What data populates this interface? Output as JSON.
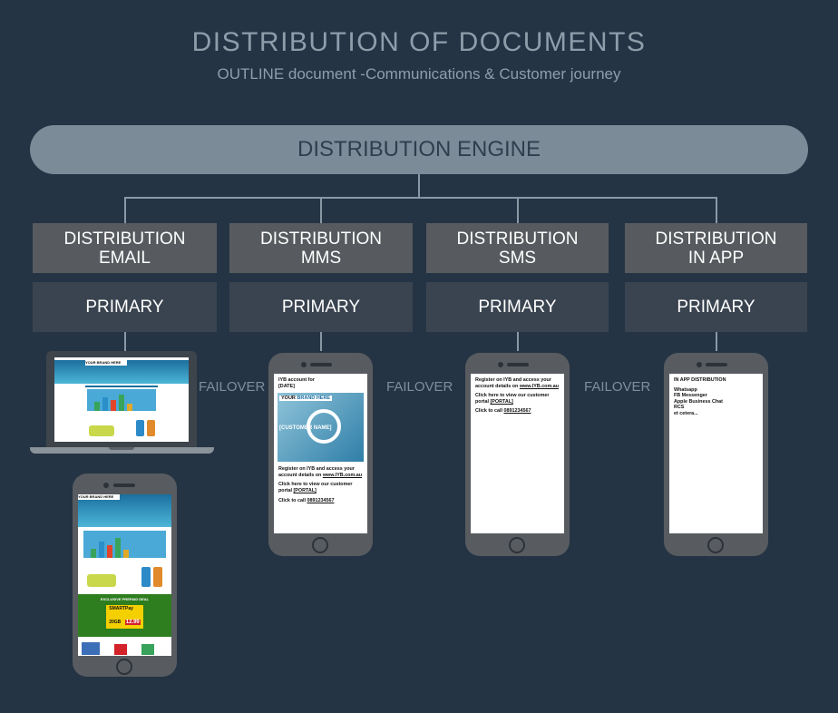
{
  "header": {
    "title": "DISTRIBUTION OF DOCUMENTS",
    "subtitle": "OUTLINE document -Communications & Customer journey"
  },
  "engine": {
    "label": "DISTRIBUTION ENGINE"
  },
  "channels": [
    {
      "line1": "DISTRIBUTION",
      "line2": "EMAIL",
      "primary": "PRIMARY"
    },
    {
      "line1": "DISTRIBUTION",
      "line2": "MMS",
      "primary": "PRIMARY"
    },
    {
      "line1": "DISTRIBUTION",
      "line2": "SMS",
      "primary": "PRIMARY"
    },
    {
      "line1": "DISTRIBUTION",
      "line2": "IN APP",
      "primary": "PRIMARY"
    }
  ],
  "failover": [
    "FAILOVER",
    "FAILOVER",
    "FAILOVER"
  ],
  "mms": {
    "line1": "IYB account for",
    "line2": "[DATE]",
    "brand_a": "YOUR",
    "brand_b": "BRAND HERE",
    "overlay": "[CUSTOMER NAME]",
    "register": "Register on IYB and access your account details on",
    "link": "www.IYB.com.au",
    "portal_text": "Click here to view our customer portal",
    "portal": "[PORTAL]",
    "call_text": "Click to call",
    "phone": "0891234567"
  },
  "sms": {
    "register": "Register on IYB and access your account details on",
    "link": "www.IYB.com.au",
    "portal_text": "Click here to view our customer portal",
    "portal": "[PORTAL]",
    "call_text": "Click to call",
    "phone": "0891234567"
  },
  "inapp": {
    "heading": "IN APP DISTRIBUTION",
    "items": [
      "Whatsapp",
      "FB Messenger",
      "Apple Business Chat",
      "RCS",
      "et cetera..."
    ]
  },
  "email_mock": {
    "brand": "YOUR BRAND HERE",
    "deal": "EXCLUSIVE PREPAID DEAL",
    "plan_name": "SMARTPay",
    "plan_data": "20GB",
    "plan_price": "12.99"
  },
  "colors": {
    "background": "#253444",
    "engine": "#7c8b98",
    "distribution_box": "#575b5f",
    "primary_box": "#3a4450"
  }
}
